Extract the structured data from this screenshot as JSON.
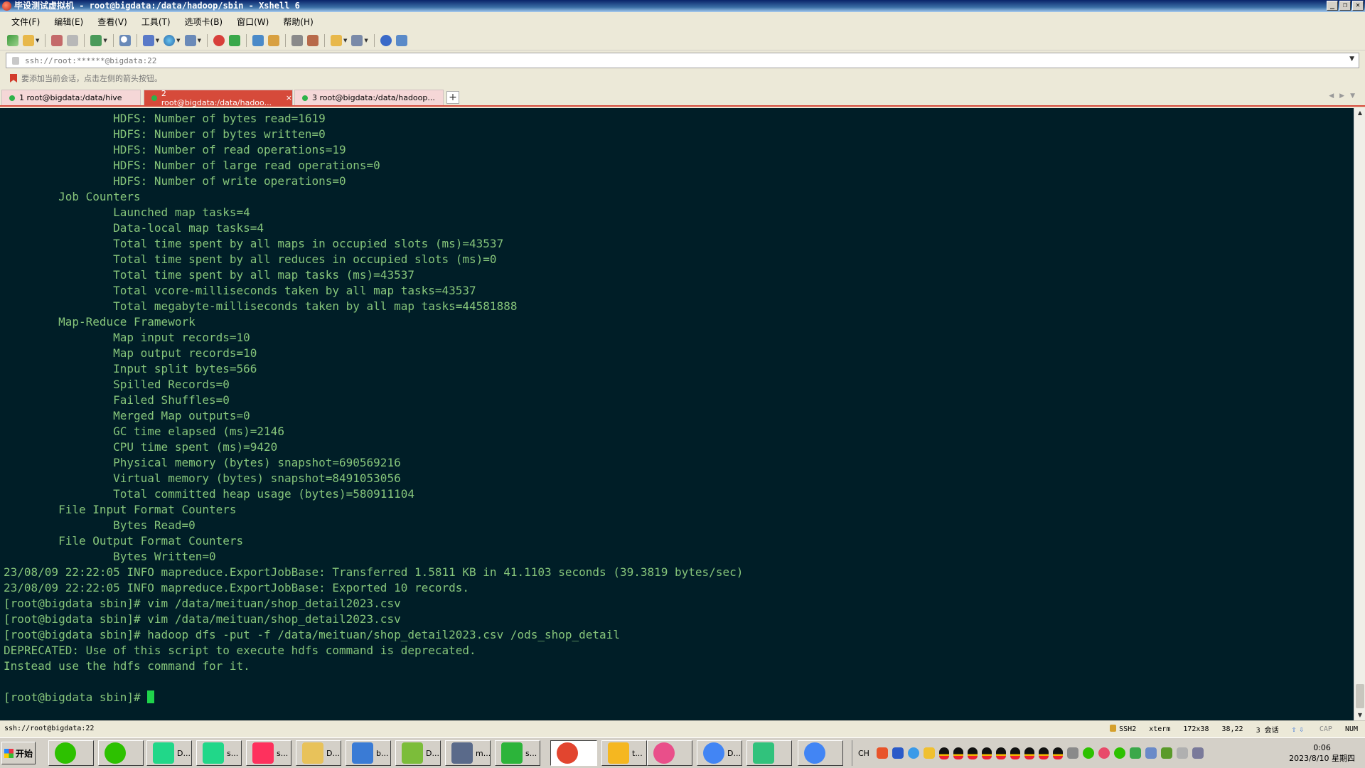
{
  "window": {
    "title": "毕设测试虚拟机 - root@bigdata:/data/hadoop/sbin - Xshell 6",
    "buttons": [
      "_",
      "❐",
      "✕"
    ]
  },
  "menu": [
    "文件(F)",
    "编辑(E)",
    "查看(V)",
    "工具(T)",
    "选项卡(B)",
    "窗口(W)",
    "帮助(H)"
  ],
  "address": {
    "value": "ssh://root:******@bigdata:22"
  },
  "hint": "要添加当前会话，点击左侧的箭头按钮。",
  "tabs": [
    {
      "label": "1 root@bigdata:/data/hive",
      "active": false
    },
    {
      "label": "2 root@bigdata:/data/hadoo...",
      "active": true,
      "close": "×"
    },
    {
      "label": "3 root@bigdata:/data/hadoop...",
      "active": false
    }
  ],
  "tab_add": "+",
  "terminal": {
    "lines": [
      "                HDFS: Number of bytes read=1619",
      "                HDFS: Number of bytes written=0",
      "                HDFS: Number of read operations=19",
      "                HDFS: Number of large read operations=0",
      "                HDFS: Number of write operations=0",
      "        Job Counters ",
      "                Launched map tasks=4",
      "                Data-local map tasks=4",
      "                Total time spent by all maps in occupied slots (ms)=43537",
      "                Total time spent by all reduces in occupied slots (ms)=0",
      "                Total time spent by all map tasks (ms)=43537",
      "                Total vcore-milliseconds taken by all map tasks=43537",
      "                Total megabyte-milliseconds taken by all map tasks=44581888",
      "        Map-Reduce Framework",
      "                Map input records=10",
      "                Map output records=10",
      "                Input split bytes=566",
      "                Spilled Records=0",
      "                Failed Shuffles=0",
      "                Merged Map outputs=0",
      "                GC time elapsed (ms)=2146",
      "                CPU time spent (ms)=9420",
      "                Physical memory (bytes) snapshot=690569216",
      "                Virtual memory (bytes) snapshot=8491053056",
      "                Total committed heap usage (bytes)=580911104",
      "        File Input Format Counters ",
      "                Bytes Read=0",
      "        File Output Format Counters ",
      "                Bytes Written=0",
      "23/08/09 22:22:05 INFO mapreduce.ExportJobBase: Transferred 1.5811 KB in 41.1103 seconds (39.3819 bytes/sec)",
      "23/08/09 22:22:05 INFO mapreduce.ExportJobBase: Exported 10 records.",
      "[root@bigdata sbin]# vim /data/meituan/shop_detail2023.csv",
      "[root@bigdata sbin]# vim /data/meituan/shop_detail2023.csv",
      "[root@bigdata sbin]# hadoop dfs -put -f /data/meituan/shop_detail2023.csv /ods_shop_detail",
      "DEPRECATED: Use of this script to execute hdfs command is deprecated.",
      "Instead use the hdfs command for it.",
      "",
      "[root@bigdata sbin]# "
    ]
  },
  "status": {
    "left": "ssh://root@bigdata:22",
    "protocol": "SSH2",
    "term": "xterm",
    "size": "172x38",
    "cursor": "38,22",
    "sessions": "3 会话",
    "cap": "CAP",
    "num": "NUM"
  },
  "taskbar": {
    "start": "开始",
    "tasks": [
      {
        "label": "",
        "icon": "wechat-icon",
        "color": "#2dc100"
      },
      {
        "label": "",
        "icon": "wechat-icon",
        "color": "#2dc100"
      },
      {
        "label": "D...",
        "icon": "pycharm-icon",
        "color": "#21d789"
      },
      {
        "label": "s...",
        "icon": "pycharm-icon",
        "color": "#21d789"
      },
      {
        "label": "s...",
        "icon": "intellij-icon",
        "color": "#fe315d"
      },
      {
        "label": "D...",
        "icon": "folder-icon",
        "color": "#e8c25a"
      },
      {
        "label": "b...",
        "icon": "notepad-icon",
        "color": "#3a7bd5"
      },
      {
        "label": "D...",
        "icon": "chart-app-icon",
        "color": "#7cbd3a"
      },
      {
        "label": "m...",
        "icon": "remote-desktop-icon",
        "color": "#5a6a8a"
      },
      {
        "label": "s...",
        "icon": "hbuilder-icon",
        "color": "#2cb43a"
      },
      {
        "label": "",
        "icon": "xshell-icon",
        "color": "#e2452f"
      },
      {
        "label": "t...",
        "icon": "qq-music-icon",
        "color": "#f5b720"
      },
      {
        "label": "",
        "icon": "photos-icon",
        "color": "#e94f8a"
      },
      {
        "label": "D...",
        "icon": "chrome-icon",
        "color": "#4285f4"
      },
      {
        "label": "",
        "icon": "music-app-icon",
        "color": "#31c27c"
      },
      {
        "label": "",
        "icon": "chrome-icon",
        "color": "#4285f4"
      }
    ],
    "lang": "CH",
    "clock_time": "0:06",
    "clock_date": "2023/8/10 星期四"
  },
  "colors": {
    "terminal_bg": "#001e27",
    "terminal_fg": "#86c57a",
    "cursor": "#1fd34b",
    "tab_active": "#d64a3a"
  }
}
